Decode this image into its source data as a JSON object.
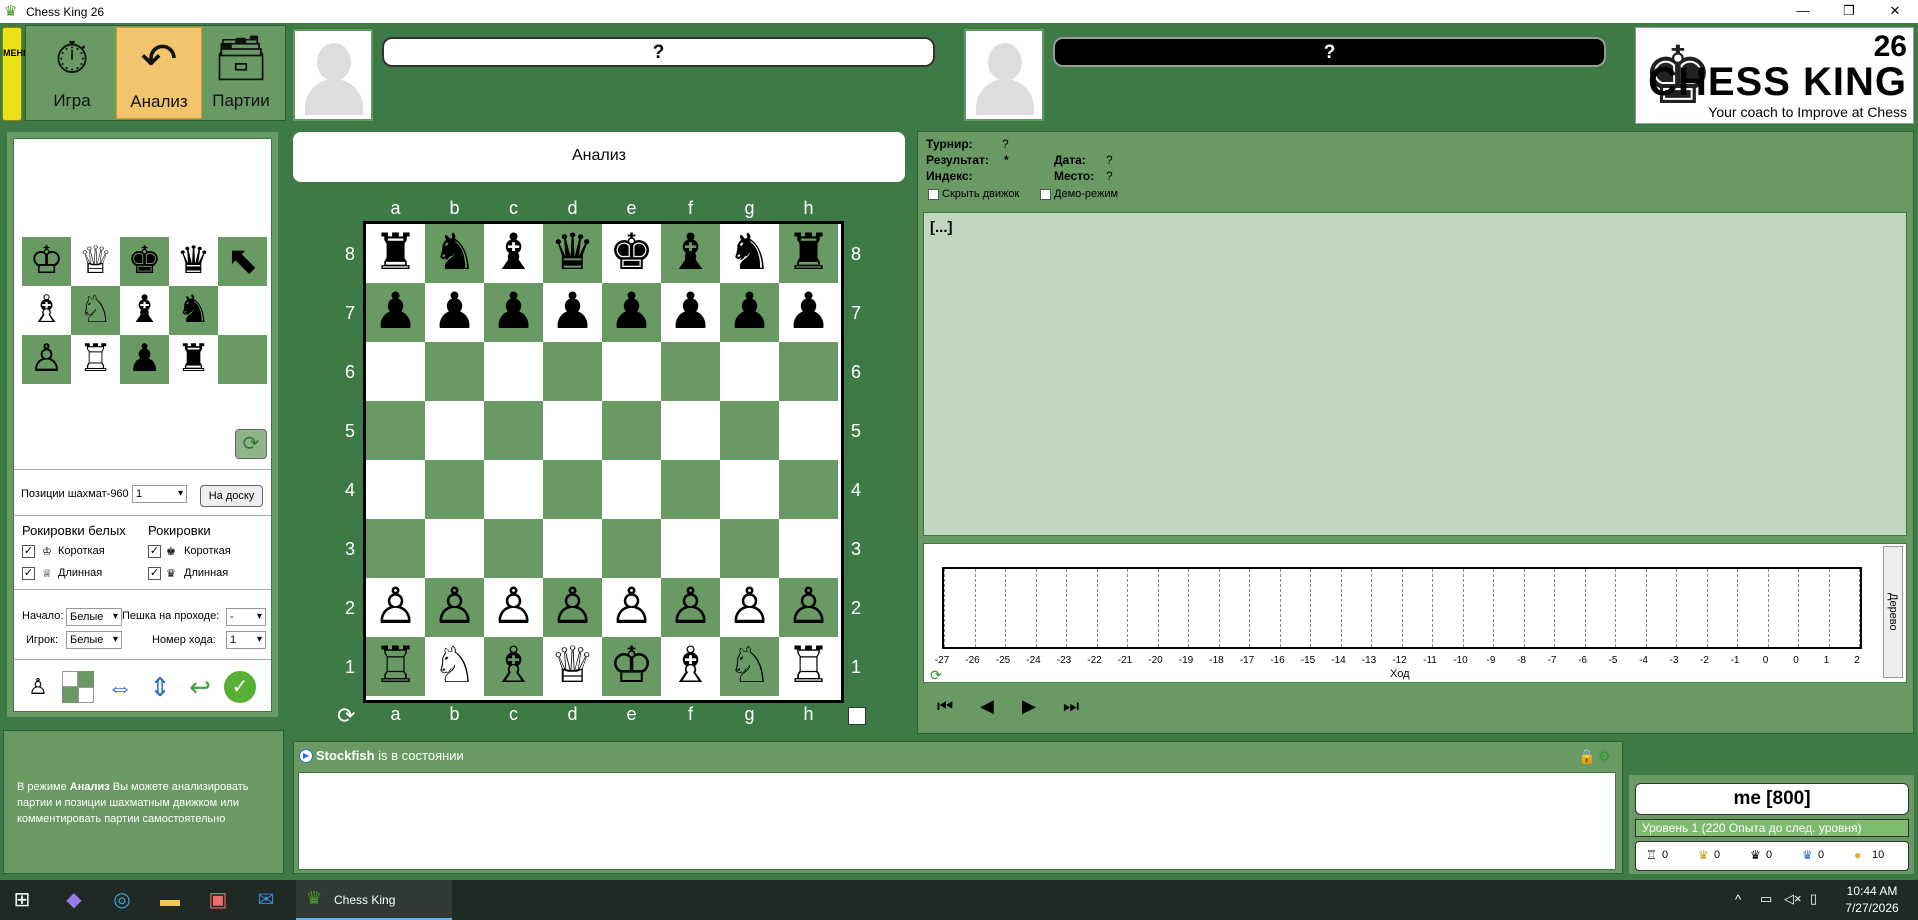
{
  "window": {
    "title": "Chess King 26",
    "min": "—",
    "max": "❐",
    "close": "✕"
  },
  "menu": {
    "label": "МЕНЮ"
  },
  "modes": [
    {
      "label": "Игра",
      "icon": "⏱"
    },
    {
      "label": "Анализ",
      "icon": "↶"
    },
    {
      "label": "Партии",
      "icon": "🗃"
    }
  ],
  "players": {
    "white_name": "?",
    "black_name": "?"
  },
  "logo": {
    "number": "26",
    "title": "CHESS KING",
    "tagline": "Your coach to Improve at Chess"
  },
  "board": {
    "title": "Анализ",
    "files": [
      "a",
      "b",
      "c",
      "d",
      "e",
      "f",
      "g",
      "h"
    ],
    "ranks": [
      "8",
      "7",
      "6",
      "5",
      "4",
      "3",
      "2",
      "1"
    ],
    "position": [
      [
        "♜",
        "♞",
        "♝",
        "♛",
        "♚",
        "♝",
        "♞",
        "♜"
      ],
      [
        "♟",
        "♟",
        "♟",
        "♟",
        "♟",
        "♟",
        "♟",
        "♟"
      ],
      [
        "",
        "",
        "",
        "",
        "",
        "",
        "",
        ""
      ],
      [
        "",
        "",
        "",
        "",
        "",
        "",
        "",
        ""
      ],
      [
        "",
        "",
        "",
        "",
        "",
        "",
        "",
        ""
      ],
      [
        "",
        "",
        "",
        "",
        "",
        "",
        "",
        ""
      ],
      [
        "♙",
        "♙",
        "♙",
        "♙",
        "♙",
        "♙",
        "♙",
        "♙"
      ],
      [
        "♖",
        "♘",
        "♗",
        "♕",
        "♔",
        "♗",
        "♘",
        "♖"
      ]
    ]
  },
  "editor": {
    "palette": [
      "♔",
      "♕",
      "♚",
      "♛",
      "⬉",
      "♗",
      "♘",
      "♝",
      "♞",
      "",
      "♙",
      "♖",
      "♟",
      "♜",
      ""
    ],
    "chess960_label": "Позиции шахмат-960",
    "chess960_value": "1",
    "to_board": "На доску",
    "castle_white_title": "Рокировки белых",
    "castle_black_title": "Рокировки",
    "short": "Короткая",
    "long": "Длинная",
    "start_label": "Начало:",
    "start_value": "Белые",
    "ep_label": "Пешка на проходе:",
    "ep_value": "-",
    "player_label": "Игрок:",
    "player_value": "Белые",
    "move_label": "Номер хода:",
    "move_value": "1"
  },
  "game": {
    "tournament_label": "Турнир:",
    "tournament": "?",
    "result_label": "Результат:",
    "result": "*",
    "index_label": "Индекс:",
    "date_label": "Дата:",
    "date": "?",
    "place_label": "Место:",
    "place": "?",
    "hide_engine": "Скрыть движок",
    "demo": "Демо-режим",
    "notation": "[...]",
    "x_ticks": [
      "-27",
      "-26",
      "-25",
      "-24",
      "-23",
      "-22",
      "-21",
      "-20",
      "-19",
      "-18",
      "-17",
      "-16",
      "-15",
      "-14",
      "-13",
      "-12",
      "-11",
      "-10",
      "-9",
      "-8",
      "-7",
      "-6",
      "-5",
      "-4",
      "-3",
      "-2",
      "-1",
      "0",
      "0",
      "1",
      "2"
    ],
    "x_label": "Ход",
    "tree_tab": "Дерево"
  },
  "engine": {
    "name": "Stockfish",
    "status": "is в состоянии"
  },
  "help": {
    "text_pre": "В режиме ",
    "text_bold": "Анализ",
    "text_post": " Вы можете анализировать партии и позиции шахматным движком или комментировать партии самостоятельно"
  },
  "player": {
    "name": "me [800]",
    "level": "Уровень 1 (220 Опыта до след. уровня)",
    "stats": [
      "0",
      "0",
      "0",
      "0",
      "10"
    ]
  },
  "taskbar": {
    "app": "Chess King",
    "time": "10:44 AM",
    "date": "7/27/2026"
  }
}
